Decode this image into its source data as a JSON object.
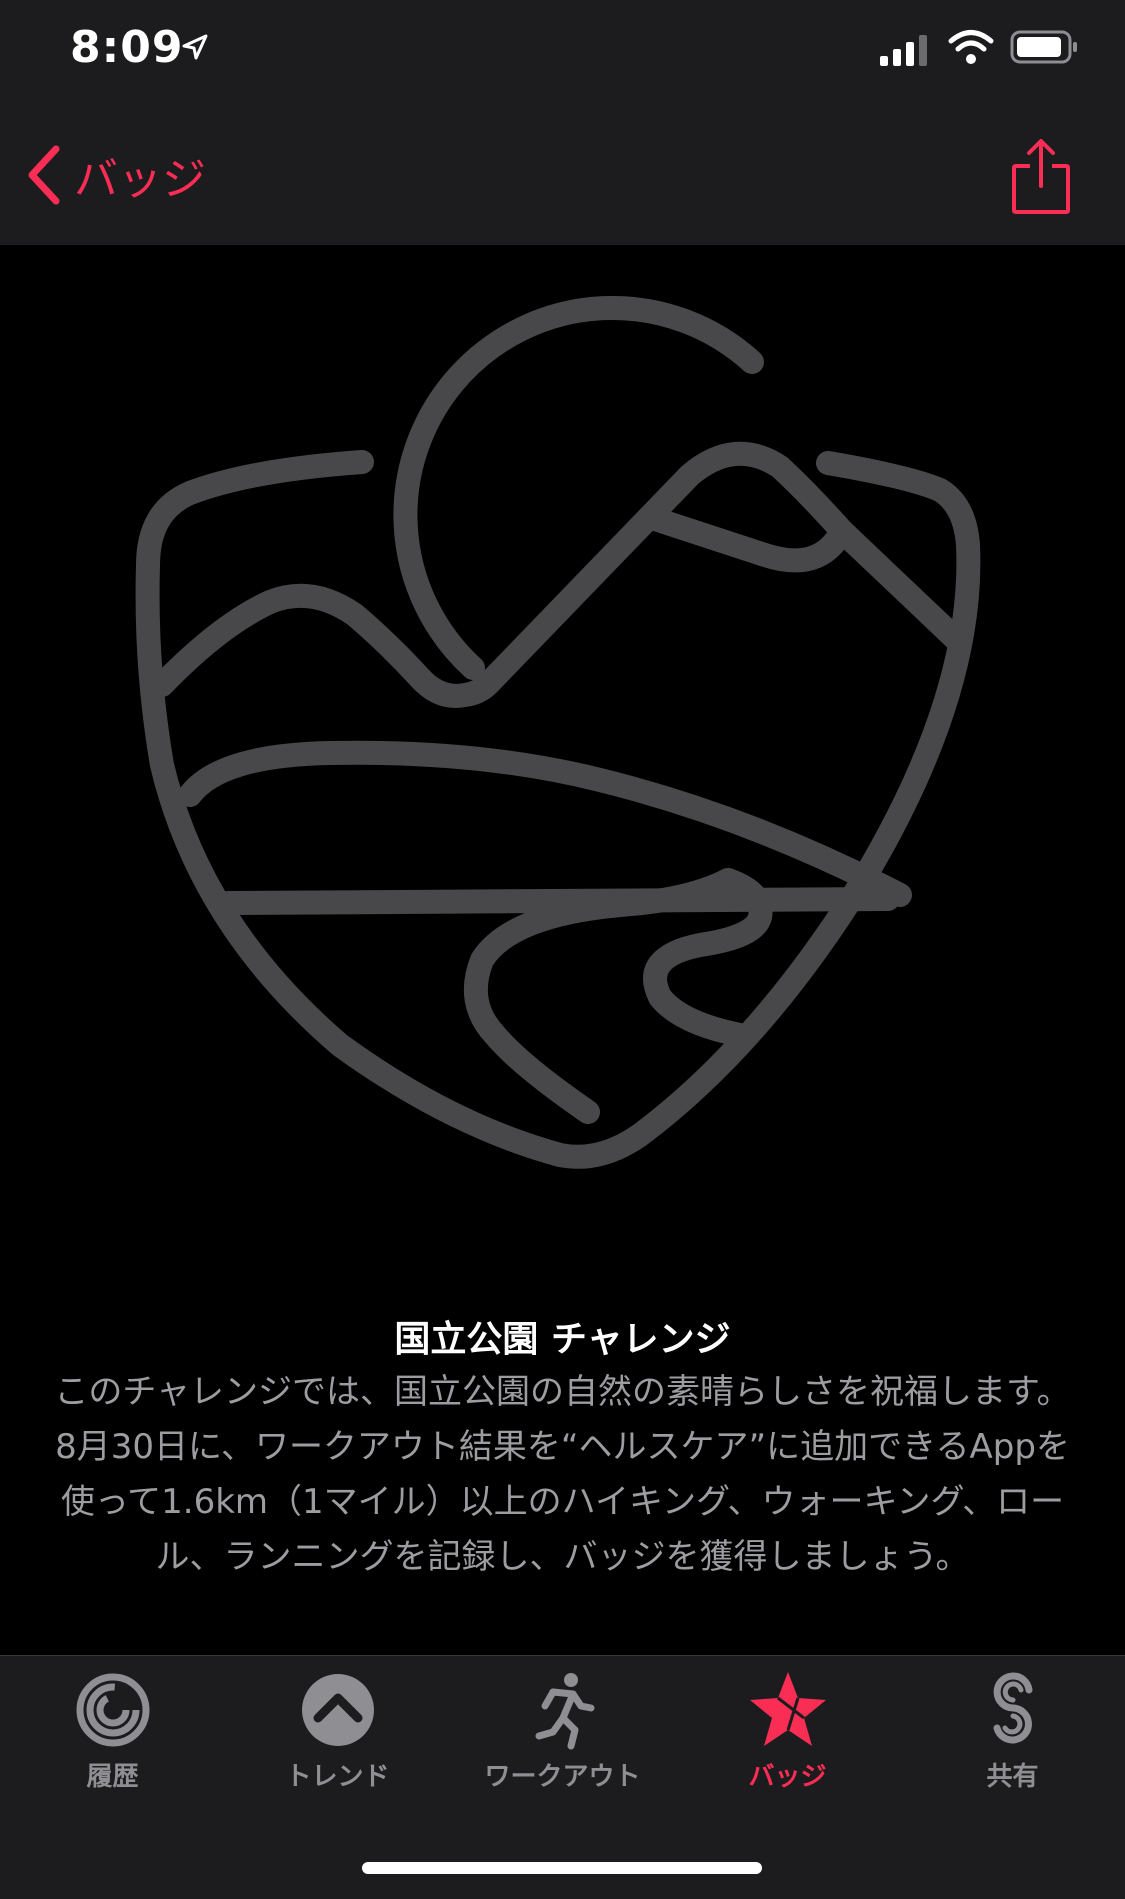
{
  "status": {
    "time": "8:09"
  },
  "nav": {
    "back_label": "バッジ"
  },
  "badge": {
    "title": "国立公園 チャレンジ",
    "description": "このチャレンジでは、国立公園の自然の素晴らしさを祝福します。8月30日に、ワークアウト結果を“ヘルスケア”に追加できるAppを使って1.6km（1マイル）以上のハイキング、ウォーキング、ロール、ランニングを記録し、バッジを獲得しましょう。"
  },
  "tabs": [
    {
      "label": "履歴",
      "icon": "activity-rings-icon"
    },
    {
      "label": "トレンド",
      "icon": "trends-icon"
    },
    {
      "label": "ワークアウト",
      "icon": "running-figure-icon"
    },
    {
      "label": "バッジ",
      "icon": "star-badge-icon",
      "active": true
    },
    {
      "label": "共有",
      "icon": "sharing-icon"
    }
  ],
  "colors": {
    "accent": "#fa2d55",
    "background": "#000000",
    "bar": "#1c1c1e",
    "badge_stroke": "#48484a",
    "secondary_text": "#9d9da1",
    "inactive_tab": "#8e8e93"
  }
}
